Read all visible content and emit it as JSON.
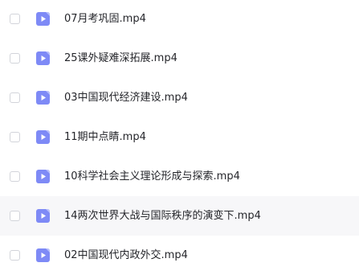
{
  "files": [
    {
      "name": "07月考巩固.mp4",
      "icon": "video-file-icon"
    },
    {
      "name": "25课外疑难深拓展.mp4",
      "icon": "video-file-icon"
    },
    {
      "name": "03中国现代经济建设.mp4",
      "icon": "video-file-icon"
    },
    {
      "name": "11期中点睛.mp4",
      "icon": "video-file-icon"
    },
    {
      "name": "10科学社会主义理论形成与探索.mp4",
      "icon": "video-file-icon"
    },
    {
      "name": "14两次世界大战与国际秩序的演变下.mp4",
      "icon": "video-file-icon"
    },
    {
      "name": "02中国现代内政外交.mp4",
      "icon": "video-file-icon"
    }
  ],
  "colors": {
    "icon_background": "#7e8af6",
    "hover_row_background": "#f7f7f9",
    "text": "#25262b",
    "checkbox_border": "#d2d4da"
  }
}
